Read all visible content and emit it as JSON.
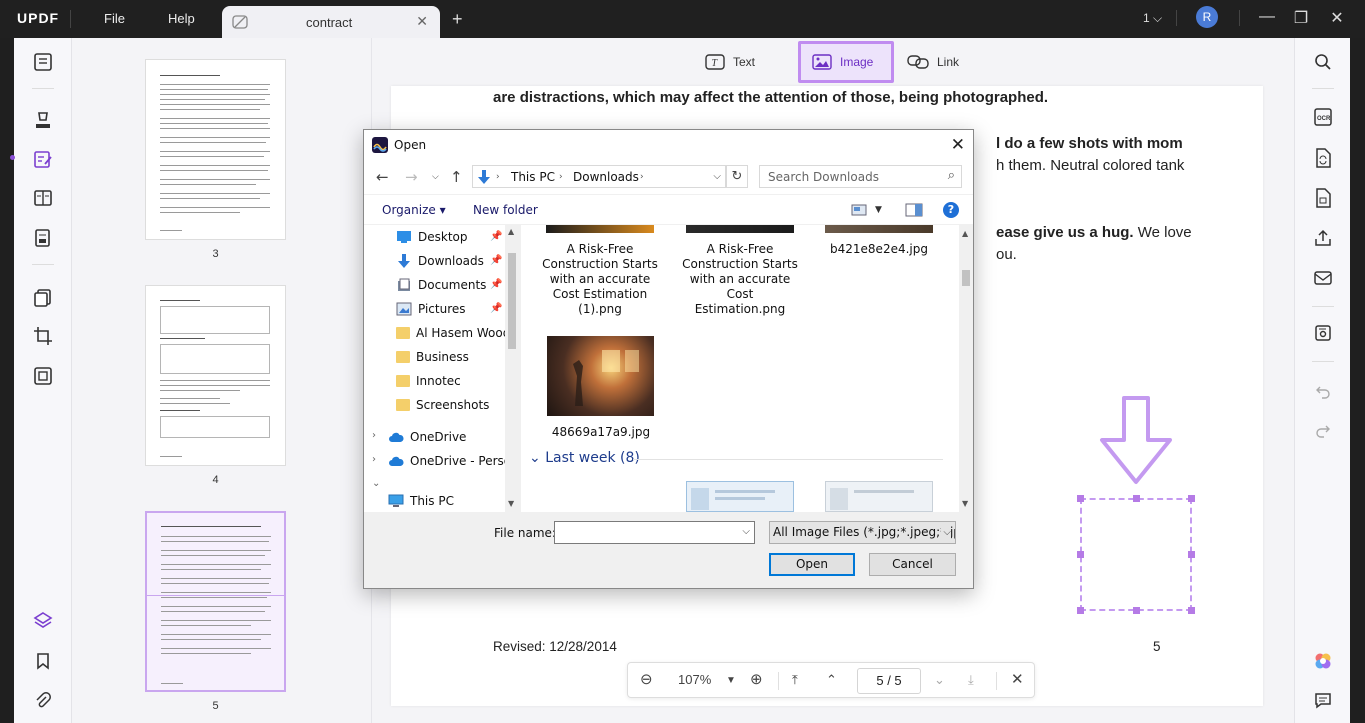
{
  "titlebar": {
    "logo": "UPDF",
    "menu": [
      "File",
      "Help"
    ],
    "tab_title": "contract",
    "page_count": "1",
    "avatar_initial": "R"
  },
  "thumbnails": [
    {
      "label": "3"
    },
    {
      "label": "4"
    },
    {
      "label": "5",
      "selected": true
    }
  ],
  "edit_toolbar": {
    "text": "Text",
    "image": "Image",
    "link": "Link",
    "active": "image"
  },
  "document": {
    "line1": "are distractions, which may affect the attention of those, being photographed.",
    "line2": "l do a few shots with mom",
    "line3": "h them. Neutral colored tank",
    "line4_bold": "ease give us a hug.",
    "line4_rest": " We love",
    "line5": "ou.",
    "revised": "Revised: 12/28/2014",
    "page_number": "5"
  },
  "zoom_bar": {
    "zoom": "107%",
    "current_page": "5",
    "total_pages": "5"
  },
  "open_dialog": {
    "title": "Open",
    "breadcrumb": [
      "This PC",
      "Downloads"
    ],
    "search_placeholder": "Search Downloads",
    "organize": "Organize",
    "new_folder": "New folder",
    "nav_items": [
      {
        "label": "Desktop",
        "icon": "desktop-icon",
        "pinned": true
      },
      {
        "label": "Downloads",
        "icon": "downloads-icon",
        "pinned": true
      },
      {
        "label": "Documents",
        "icon": "documents-icon",
        "pinned": true
      },
      {
        "label": "Pictures",
        "icon": "pictures-icon",
        "pinned": true
      },
      {
        "label": "Al Hasem Wood",
        "icon": "folder-icon"
      },
      {
        "label": "Business",
        "icon": "folder-icon"
      },
      {
        "label": "Innotec",
        "icon": "folder-icon"
      },
      {
        "label": "Screenshots",
        "icon": "folder-icon"
      },
      {
        "label": "OneDrive",
        "icon": "cloud-icon",
        "expandable": true
      },
      {
        "label": "OneDrive - Persor",
        "icon": "cloud-icon",
        "expandable": true
      },
      {
        "label": "This PC",
        "icon": "pc-icon",
        "expanded": true
      }
    ],
    "files": [
      {
        "name": "A Risk-Free Construction Starts with an accurate Cost Estimation (1).png"
      },
      {
        "name": "A Risk-Free Construction Starts with an accurate Cost Estimation.png"
      },
      {
        "name": "b421e8e2e4.jpg"
      },
      {
        "name": "48669a17a9.jpg"
      }
    ],
    "group_header": "Last week (8)",
    "file_name_label": "File name:",
    "file_name_value": "",
    "filter": "All Image Files (*.jpg;*.jpeg;*.jp",
    "open_button": "Open",
    "cancel_button": "Cancel"
  },
  "colors": {
    "accent": "#b57be6",
    "titlebar": "#202020",
    "dialog_primary": "#0078d7"
  }
}
